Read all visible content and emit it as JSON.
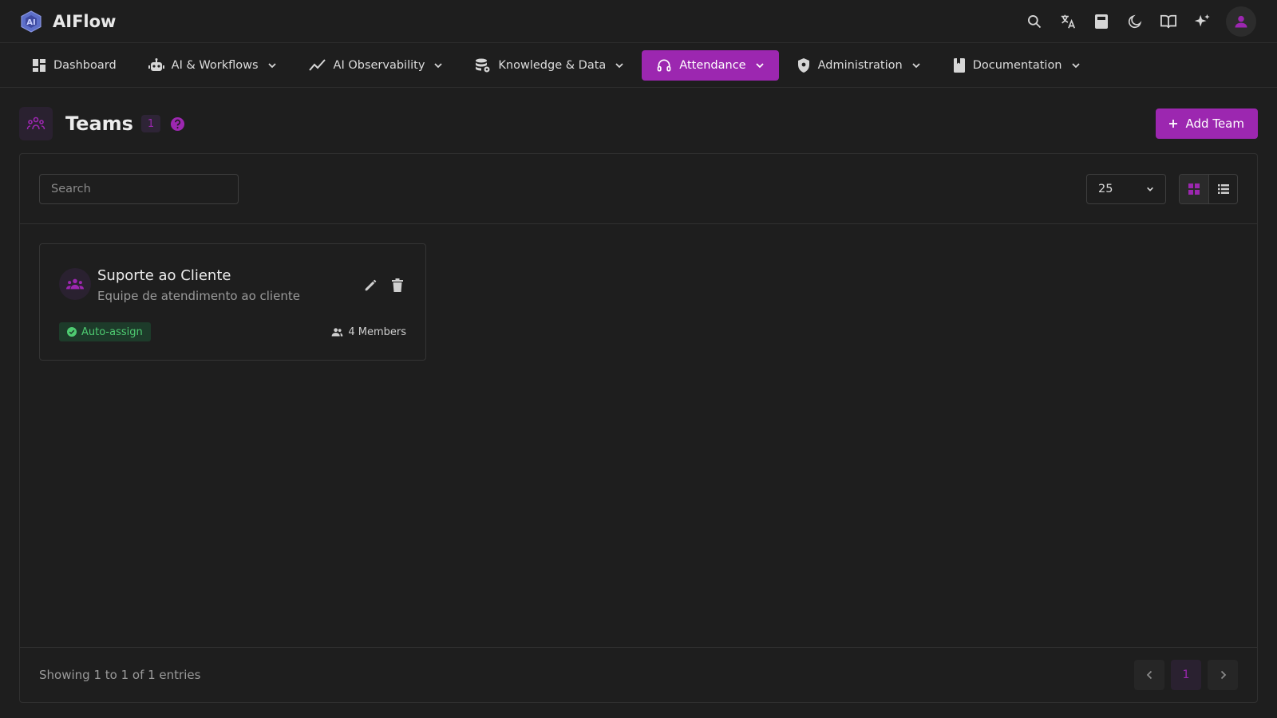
{
  "app": {
    "name": "AIFlow"
  },
  "topbar": {
    "icons": [
      "search-icon",
      "translate-icon",
      "calculator-icon",
      "moon-icon",
      "book-icon",
      "sparkle-icon",
      "user-icon"
    ]
  },
  "nav": {
    "items": [
      {
        "label": "Dashboard",
        "icon": "dashboard-icon",
        "dropdown": false,
        "active": false
      },
      {
        "label": "AI & Workflows",
        "icon": "robot-icon",
        "dropdown": true,
        "active": false
      },
      {
        "label": "AI Observability",
        "icon": "trend-icon",
        "dropdown": true,
        "active": false
      },
      {
        "label": "Knowledge & Data",
        "icon": "database-icon",
        "dropdown": true,
        "active": false
      },
      {
        "label": "Attendance",
        "icon": "headset-icon",
        "dropdown": true,
        "active": true
      },
      {
        "label": "Administration",
        "icon": "shield-icon",
        "dropdown": true,
        "active": false
      },
      {
        "label": "Documentation",
        "icon": "bookmark-icon",
        "dropdown": true,
        "active": false
      }
    ]
  },
  "page": {
    "title": "Teams",
    "count": "1",
    "add_label": "Add Team"
  },
  "toolbar": {
    "search_placeholder": "Search",
    "page_size": "25"
  },
  "teams": [
    {
      "name": "Suporte ao Cliente",
      "description": "Equipe de atendimento ao cliente",
      "badge": "Auto-assign",
      "members": "4 Members"
    }
  ],
  "footer": {
    "entries": "Showing 1 to 1 of 1 entries",
    "current_page": "1"
  },
  "colors": {
    "accent": "#9c27b0",
    "success": "#4ecb71",
    "background": "#1e1e1e"
  }
}
